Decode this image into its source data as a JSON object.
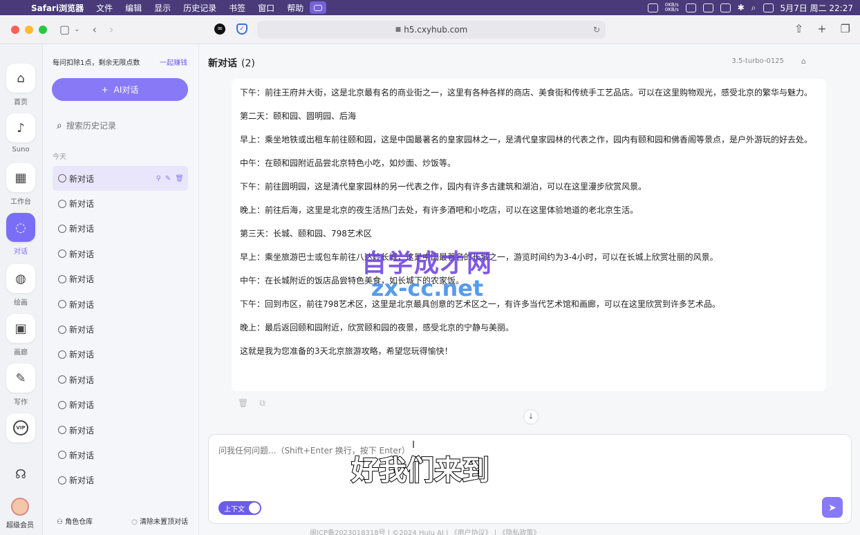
{
  "menubar": {
    "app": "Safari浏览器",
    "items": [
      "文件",
      "编辑",
      "显示",
      "历史记录",
      "书签",
      "窗口",
      "帮助"
    ],
    "net_up": "0KB/s",
    "net_down": "0KB/s",
    "datetime": "5月7日 周二  22:27"
  },
  "browser": {
    "url": "h5.cxyhub.com"
  },
  "rail": {
    "items": [
      {
        "label": "首页",
        "icon": "home-icon"
      },
      {
        "label": "Suno",
        "icon": "music-icon"
      },
      {
        "label": "工作台",
        "icon": "grid-icon"
      },
      {
        "label": "对话",
        "icon": "chat-icon"
      },
      {
        "label": "绘画",
        "icon": "palette-icon"
      },
      {
        "label": "画廊",
        "icon": "image-icon"
      },
      {
        "label": "写作",
        "icon": "pen-icon"
      }
    ],
    "vip": "VIP",
    "member_label": "超级会员"
  },
  "sidebar": {
    "quota_text": "每问扣除1点，剩余无限点数",
    "earn_link": "一起赚钱",
    "new_chat": "AI对话",
    "search_placeholder": "搜索历史记录",
    "section_today": "今天",
    "history": [
      "新对话",
      "新对话",
      "新对话",
      "新对话",
      "新对话",
      "新对话",
      "新对话",
      "新对话",
      "新对话",
      "新对话",
      "新对话",
      "新对话",
      "新对话"
    ],
    "role_library": "角色仓库",
    "clear_unpinned": "清除未置顶对话"
  },
  "chat": {
    "title": "新对话",
    "count": "(2)",
    "model": "3.5-turbo-0125",
    "paragraphs": [
      "下午：前往王府井大街，这是北京最有名的商业街之一，这里有各种各样的商店、美食街和传统手工艺品店。可以在这里购物观光，感受北京的繁华与魅力。",
      "第二天：颐和园、圆明园、后海",
      "早上：乘坐地铁或出租车前往颐和园，这是中国最著名的皇家园林之一，是清代皇家园林的代表之作，园内有颐和园和佛香阁等景点，是户外游玩的好去处。",
      "中午：在颐和园附近品尝北京特色小吃，如炒面、炒饭等。",
      "下午：前往圆明园，这是清代皇家园林的另一代表之作，园内有许多古建筑和湖泊，可以在这里漫步欣赏风景。",
      "晚上：前往后海，这里是北京的夜生活热门去处，有许多酒吧和小吃店，可以在这里体验地道的老北京生活。",
      "第三天：长城、颐和园、798艺术区",
      "早上：乘坐旅游巴士或包车前往八达岭长城，这是中国最著名的长城之一，游览时间约为3-4小时，可以在长城上欣赏壮丽的风景。",
      "中午：在长城附近的饭店品尝特色美食，如长城下的农家饭。",
      "下午：回到市区，前往798艺术区，这里是北京最具创意的艺术区之一，有许多当代艺术馆和画廊，可以在这里欣赏到许多艺术品。",
      "晚上：最后返回颐和园附近，欣赏颐和园的夜景，感受北京的宁静与美丽。",
      "这就是我为您准备的3天北京旅游攻略，希望您玩得愉快！"
    ],
    "input_placeholder": "问我任何问题...（Shift+Enter 换行，按下 Enter）",
    "context_toggle": "上下文",
    "footer": "闽ICP备2023018318号  |  ©2024 Hulu AI  |  《用户协议》  |  《隐私政策》"
  },
  "overlay": {
    "watermark_line1": "自学成才网",
    "watermark_line2": "zx-cc.net",
    "subtitle": "好我们来到"
  },
  "colors": {
    "accent": "#8879f7",
    "menubar": "#4a3a7a"
  }
}
